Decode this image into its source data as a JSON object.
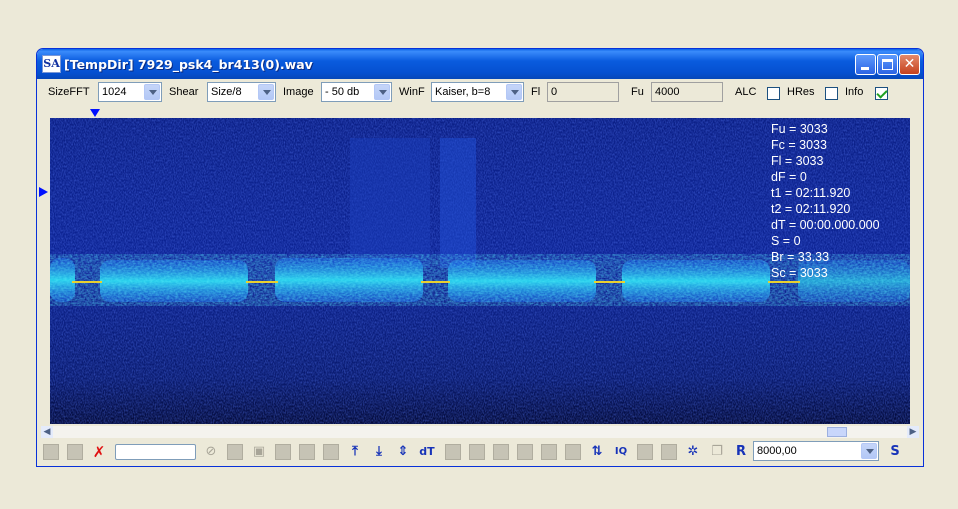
{
  "window": {
    "app_icon_text": "SA",
    "title": "[TempDir] 7929_psk4_br413(0).wav"
  },
  "toolbar": {
    "sizefft": {
      "label": "SizeFFT",
      "value": "1024"
    },
    "shear": {
      "label": "Shear",
      "value": "Size/8"
    },
    "image": {
      "label": "Image",
      "value": "- 50 db"
    },
    "winf": {
      "label": "WinF",
      "value": "Kaiser, b=8"
    },
    "fl": {
      "label": "Fl",
      "value": "0"
    },
    "fu": {
      "label": "Fu",
      "value": "4000"
    },
    "alc": {
      "label": "ALC",
      "checked": false
    },
    "hres": {
      "label": "HRes",
      "checked": false
    },
    "info": {
      "label": "Info",
      "checked": true
    }
  },
  "readout": [
    "Fu = 3033",
    "Fc = 3033",
    "Fl = 3033",
    "dF = 0",
    "t1 = 02:11.920",
    "t2 = 02:11.920",
    "dT = 00:00.000.000",
    "S = 0",
    "Br = 33.33",
    "Sc = 3033"
  ],
  "bottom": {
    "zoom_value": "8000,00",
    "dt_label": "dT",
    "r_label": "R",
    "s_label": "S",
    "iq_label": "IQ"
  },
  "colors": {
    "spectrogram_bg": "#0a1a78",
    "signal": "#20d8f0",
    "tone_line": "#e8d030",
    "accent": "#0831d9"
  }
}
